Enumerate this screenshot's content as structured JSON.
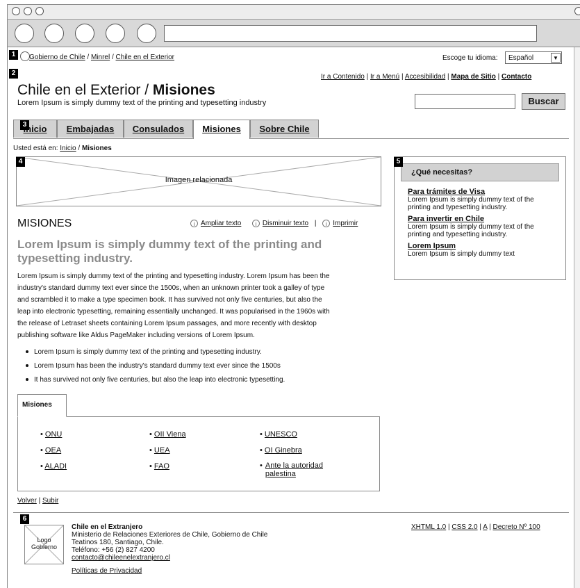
{
  "badges": [
    "1",
    "2",
    "3",
    "4",
    "5",
    "6"
  ],
  "breadcrumb_top": {
    "gobierno": "Gobierno de Chile",
    "sep1": " / ",
    "minrel": "Minrel",
    "sep2": " / ",
    "chile": "Chile en el Exterior"
  },
  "language": {
    "label": "Escoge tu idioma:",
    "value": "Español"
  },
  "util_links": {
    "contenido": "Ir a Contenido",
    "menu": "Ir a Menú",
    "accesibilidad": "Accesibilidad",
    "mapa": "Mapa de Sitio",
    "contacto": "Contacto",
    "sep": " | "
  },
  "header": {
    "title_regular": "Chile en el Exterior / ",
    "title_bold": "Misiones",
    "tagline": "Lorem Ipsum is simply dummy text of the printing and typesetting industry"
  },
  "search": {
    "button": "Buscar",
    "value": ""
  },
  "tabs": [
    "Inicio",
    "Embajadas",
    "Consulados",
    "Misiones",
    "Sobre Chile"
  ],
  "location": {
    "prefix": "Usted está en: ",
    "inicio": "Inicio",
    "sep": " / ",
    "current": "Misiones"
  },
  "image_label": "Imagen relacionada",
  "section_title": "MISIONES",
  "tools": {
    "ampliar": "Ampliar texto",
    "disminuir": "Disminuir texto",
    "imprimir": "Imprimir",
    "sep": "|"
  },
  "headline": "Lorem Ipsum is simply dummy text of the printing and typesetting industry.",
  "paragraph_lines": [
    "Lorem Ipsum is simply dummy text of the printing and typesetting industry. Lorem Ipsum has been the",
    "industry's standard dummy text ever since the 1500s, when an unknown printer took a galley of type",
    "and scrambled it to make a type specimen book. It has survived not only five centuries, but also the",
    "leap into electronic typesetting, remaining essentially unchanged. It was popularised in the 1960s with",
    "the release of Letraset sheets containing Lorem Ipsum passages, and more recently with desktop",
    "publishing software like Aldus PageMaker including versions of Lorem Ipsum."
  ],
  "bullets": [
    "Lorem Ipsum is simply dummy text of the printing and typesetting industry.",
    "Lorem Ipsum has been the industry's standard dummy text ever since the 1500s",
    "It has survived not only five centuries, but also the leap into electronic typesetting."
  ],
  "misiones_box": {
    "tab": "Misiones",
    "col1": [
      "ONU",
      "OEA",
      "ALADI"
    ],
    "col2": [
      "OII Viena",
      "UEA",
      "FAO"
    ],
    "col3": [
      "UNESCO",
      "OI Ginebra",
      "Ante la autoridad palestina"
    ]
  },
  "bottom_links": {
    "volver": "Volver",
    "sep": " | ",
    "subir": "Subir"
  },
  "sidebar": {
    "title": "¿Qué necesitas?",
    "items": [
      {
        "link": "Para trámites de Visa",
        "text": "Lorem Ipsum is simply dummy text of the printing and typesetting industry."
      },
      {
        "link": "Para invertir en Chile",
        "text": "Lorem Ipsum is simply dummy text of the printing and typesetting industry."
      },
      {
        "link": "Lorem Ipsum",
        "text": "Lorem Ipsum is simply dummy text"
      }
    ]
  },
  "footer": {
    "logo": "Logo Gobierno",
    "org": "Chile en el Extranjero",
    "ministry": "Ministerio de Relaciones Exteriores de Chile, Gobierno de Chile",
    "address": "Teatinos 180, Santiago, Chile.",
    "phone": "Teléfono: +56 (2) 827 4200",
    "email": "contacto@chileenelextranjero.cl",
    "privacy": "Políticas de Privacidad",
    "xhtml": "XHTML 1.0",
    "css": "CSS 2.0",
    "a": "A",
    "decreto": "Decreto Nº 100",
    "sep": " | "
  }
}
